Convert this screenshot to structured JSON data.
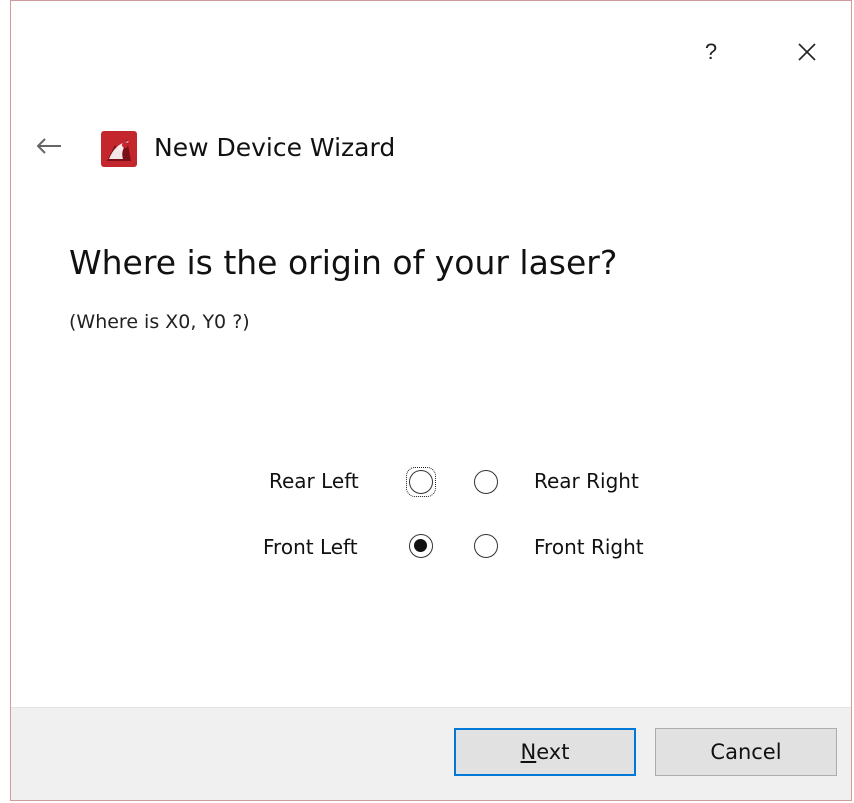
{
  "window": {
    "help_symbol": "?",
    "close_symbol": "✕"
  },
  "nav": {
    "back_icon": "arrow-left-icon",
    "app_icon": "lightburn-logo-icon",
    "wizard_title": "New Device Wizard"
  },
  "page": {
    "heading": "Where is the origin of your laser?",
    "subheading": "(Where is X0, Y0 ?)"
  },
  "origin_options": {
    "rear_left": {
      "label": "Rear Left",
      "checked": false,
      "focused": true
    },
    "rear_right": {
      "label": "Rear Right",
      "checked": false
    },
    "front_left": {
      "label": "Front Left",
      "checked": true
    },
    "front_right": {
      "label": "Front Right",
      "checked": false
    }
  },
  "footer": {
    "next_accel": "N",
    "next_rest": "ext",
    "cancel_label": "Cancel"
  },
  "colors": {
    "focus_border": "#0078d7",
    "footer_bg": "#f0f0f0",
    "logo_red": "#c4262e"
  }
}
